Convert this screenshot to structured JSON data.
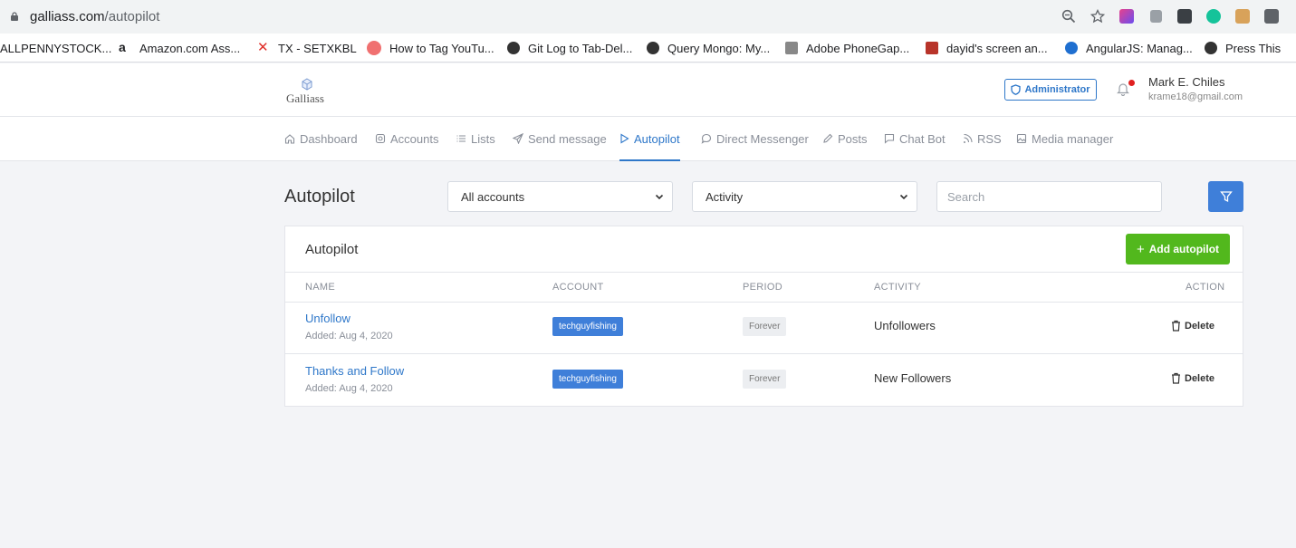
{
  "browser": {
    "url_domain": "galliass.com",
    "url_path": "/autopilot",
    "bookmarks": [
      {
        "label": "ALLPENNYSTOCK...",
        "color": "#ffffff"
      },
      {
        "label": "Amazon.com Ass...",
        "color": "#222222"
      },
      {
        "label": "TX - SETXKBL",
        "color": "#e0302a"
      },
      {
        "label": "How to Tag YouTu...",
        "color": "#f07070"
      },
      {
        "label": "Git Log to Tab-Del...",
        "color": "#333333"
      },
      {
        "label": "Query Mongo: My...",
        "color": "#333333"
      },
      {
        "label": "Adobe PhoneGap...",
        "color": "#777777"
      },
      {
        "label": "dayid's screen an...",
        "color": "#b8342a"
      },
      {
        "label": "AngularJS: Manag...",
        "color": "#1f6fd0"
      },
      {
        "label": "Press This",
        "color": "#333333"
      }
    ]
  },
  "header": {
    "logo_text": "Galliass",
    "admin_label": "Administrator",
    "user_name": "Mark E. Chiles",
    "user_email": "krame18@gmail.com"
  },
  "nav": {
    "items": [
      {
        "label": "Dashboard",
        "icon": "home-icon",
        "active": false
      },
      {
        "label": "Accounts",
        "icon": "instagram-icon",
        "active": false
      },
      {
        "label": "Lists",
        "icon": "list-icon",
        "active": false
      },
      {
        "label": "Send message",
        "icon": "send-icon",
        "active": false
      },
      {
        "label": "Autopilot",
        "icon": "play-icon",
        "active": true
      },
      {
        "label": "Direct Messenger",
        "icon": "chat-bubble-icon",
        "active": false
      },
      {
        "label": "Posts",
        "icon": "pencil-icon",
        "active": false
      },
      {
        "label": "Chat Bot",
        "icon": "message-square-icon",
        "active": false
      },
      {
        "label": "RSS",
        "icon": "rss-icon",
        "active": false
      },
      {
        "label": "Media manager",
        "icon": "image-icon",
        "active": false
      }
    ]
  },
  "toolbar": {
    "title": "Autopilot",
    "accounts_select": "All accounts",
    "activity_select": "Activity",
    "search_placeholder": "Search"
  },
  "card": {
    "title": "Autopilot",
    "add_label": "Add autopilot",
    "columns": [
      "NAME",
      "ACCOUNT",
      "PERIOD",
      "ACTIVITY",
      "ACTION"
    ],
    "rows": [
      {
        "name": "Unfollow",
        "added": "Added: Aug 4, 2020",
        "account": "techguyfishing",
        "period": "Forever",
        "activity": "Unfollowers",
        "action": "Delete"
      },
      {
        "name": "Thanks and Follow",
        "added": "Added: Aug 4, 2020",
        "account": "techguyfishing",
        "period": "Forever",
        "activity": "New Followers",
        "action": "Delete"
      }
    ]
  },
  "colors": {
    "primary": "#2e77c9",
    "add_button": "#52b81d",
    "notification": "#e02020"
  }
}
